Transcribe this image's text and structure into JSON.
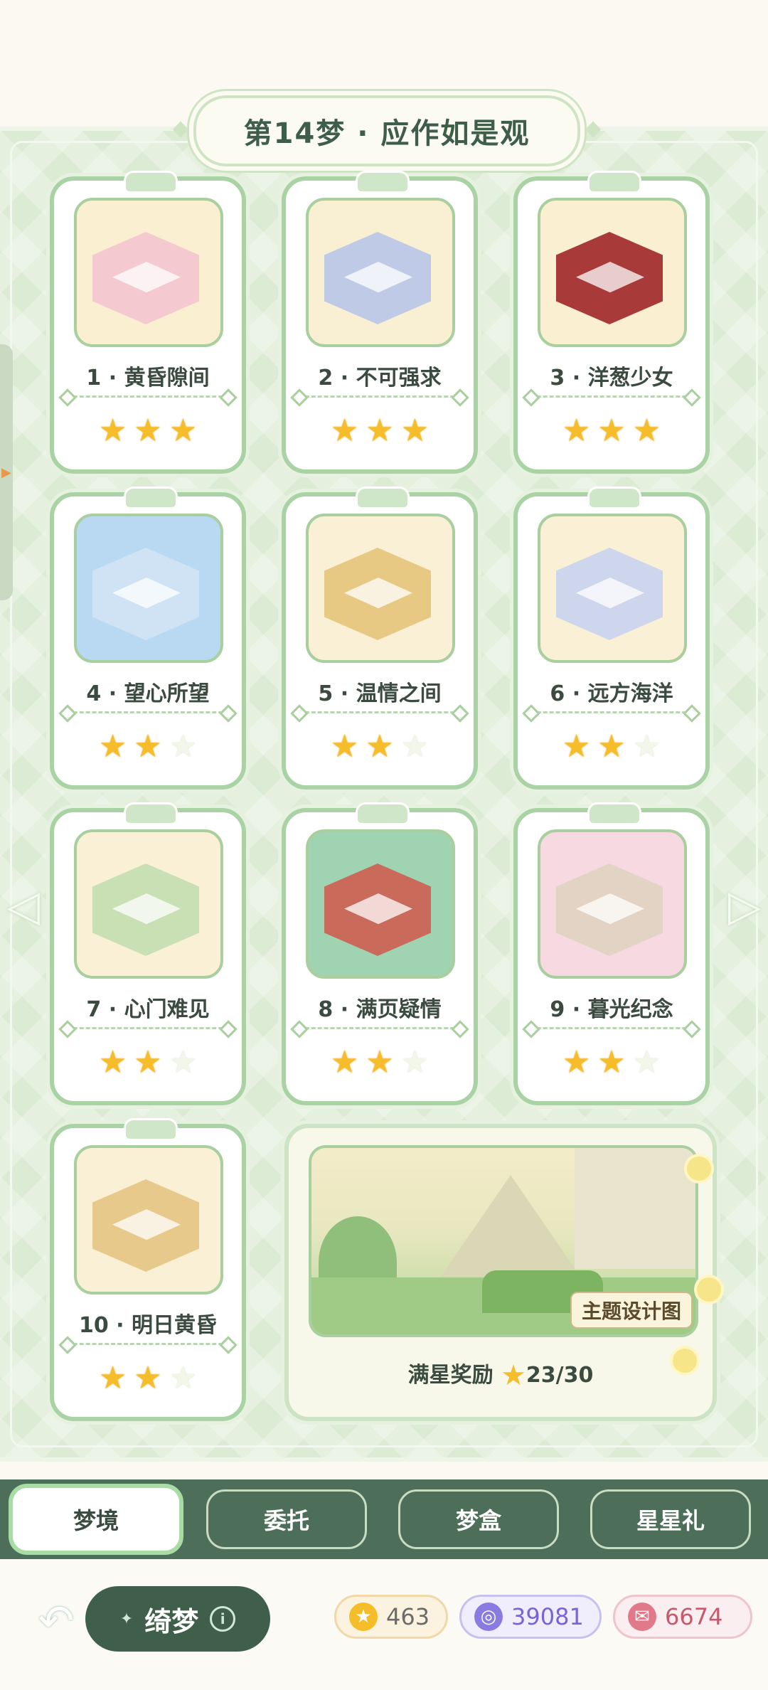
{
  "header": {
    "title": "第14梦 · 应作如是观"
  },
  "levels": [
    {
      "label": "1 · 黄昏隙间",
      "stars": 3,
      "theme_color": "#f4c9cf",
      "bg_color": "#fbefd1"
    },
    {
      "label": "2 · 不可强求",
      "stars": 3,
      "theme_color": "#bfcbe6",
      "bg_color": "#f9efd2"
    },
    {
      "label": "3 · 洋葱少女",
      "stars": 3,
      "theme_color": "#a83a3a",
      "bg_color": "#fbefd1"
    },
    {
      "label": "4 · 望心所望",
      "stars": 2,
      "theme_color": "#cfe3f5",
      "bg_color": "#b9d9f2"
    },
    {
      "label": "5 · 温情之间",
      "stars": 2,
      "theme_color": "#e7c983",
      "bg_color": "#faf0d5"
    },
    {
      "label": "6 · 远方海洋",
      "stars": 2,
      "theme_color": "#cdd6ec",
      "bg_color": "#faf0d5"
    },
    {
      "label": "7 · 心门难见",
      "stars": 2,
      "theme_color": "#c8e0b3",
      "bg_color": "#faf0d5"
    },
    {
      "label": "8 · 满页疑情",
      "stars": 2,
      "theme_color": "#c96a5a",
      "bg_color": "#9fd3b1"
    },
    {
      "label": "9 · 暮光纪念",
      "stars": 2,
      "theme_color": "#e3d3c4",
      "bg_color": "#f6d9e1"
    },
    {
      "label": "10 · 明日黄昏",
      "stars": 2,
      "theme_color": "#e8c98c",
      "bg_color": "#faf0d5"
    }
  ],
  "reward": {
    "label": "满星奖励",
    "progress": "23/30",
    "design_tag": "主题设计图"
  },
  "tabs": [
    {
      "label": "梦境",
      "active": true
    },
    {
      "label": "委托",
      "active": false
    },
    {
      "label": "梦盒",
      "active": false
    },
    {
      "label": "星星礼",
      "active": false
    }
  ],
  "footer": {
    "title": "绮梦",
    "currencies": [
      {
        "value": "463",
        "icon": "star-icon",
        "color": "#6b6b6b",
        "bg": "#fbf3df",
        "border": "#f0d8a8",
        "icon_bg": "#f6bd2b"
      },
      {
        "value": "39081",
        "icon": "dream-coin-icon",
        "color": "#7a63d6",
        "bg": "#f0eefc",
        "border": "#c8c0f0",
        "icon_bg": "#8a7be0"
      },
      {
        "value": "6674",
        "icon": "gift-ticket-icon",
        "color": "#c65a6d",
        "bg": "#fbeef0",
        "border": "#f0c4cc",
        "icon_bg": "#e07a8a"
      }
    ]
  }
}
